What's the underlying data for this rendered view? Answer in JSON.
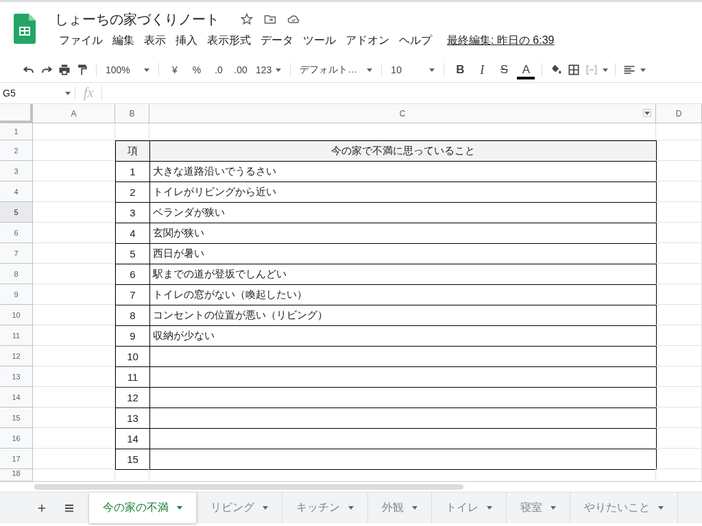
{
  "document": {
    "title": "しょーちの家づくりノート",
    "last_edit": "最終編集: 昨日の 6:39"
  },
  "menu": [
    "ファイル",
    "編集",
    "表示",
    "挿入",
    "表示形式",
    "データ",
    "ツール",
    "アドオン",
    "ヘルプ"
  ],
  "toolbar": {
    "zoom": "100%",
    "currency": "¥",
    "percent": "%",
    "decimal_decrease": ".0",
    "decimal_increase": ".00",
    "number_format": "123",
    "font": "デフォルト…",
    "font_size": "10",
    "bold": "B",
    "italic": "I",
    "strikethrough": "S",
    "text_color": "A"
  },
  "formula_bar": {
    "cell_ref": "G5",
    "fx": "fx"
  },
  "columns": [
    {
      "label": "A",
      "selected": false
    },
    {
      "label": "B",
      "selected": false
    },
    {
      "label": "C",
      "selected": false
    },
    {
      "label": "D",
      "selected": false
    }
  ],
  "row_headers": [
    {
      "label": "1",
      "selected": false
    },
    {
      "label": "2",
      "selected": false
    },
    {
      "label": "3",
      "selected": false
    },
    {
      "label": "4",
      "selected": false
    },
    {
      "label": "5",
      "selected": true
    },
    {
      "label": "6",
      "selected": false
    },
    {
      "label": "7",
      "selected": false
    },
    {
      "label": "8",
      "selected": false
    },
    {
      "label": "9",
      "selected": false
    },
    {
      "label": "10",
      "selected": false
    },
    {
      "label": "11",
      "selected": false
    },
    {
      "label": "12",
      "selected": false
    },
    {
      "label": "13",
      "selected": false
    },
    {
      "label": "14",
      "selected": false
    },
    {
      "label": "15",
      "selected": false
    },
    {
      "label": "16",
      "selected": false
    },
    {
      "label": "17",
      "selected": false
    },
    {
      "label": "18",
      "selected": false
    }
  ],
  "table": {
    "header": [
      "項",
      "今の家で不満に思っていること"
    ],
    "rows": [
      {
        "no": "1",
        "text": "大きな道路沿いでうるさい"
      },
      {
        "no": "2",
        "text": "トイレがリビングから近い"
      },
      {
        "no": "3",
        "text": "ベランダが狭い"
      },
      {
        "no": "4",
        "text": "玄関が狭い"
      },
      {
        "no": "5",
        "text": "西日が暑い"
      },
      {
        "no": "6",
        "text": "駅までの道が登坂でしんどい"
      },
      {
        "no": "7",
        "text": "トイレの窓がない（喚起したい）"
      },
      {
        "no": "8",
        "text": "コンセントの位置が悪い（リビング）"
      },
      {
        "no": "9",
        "text": "収納が少ない"
      },
      {
        "no": "10",
        "text": ""
      },
      {
        "no": "11",
        "text": ""
      },
      {
        "no": "12",
        "text": ""
      },
      {
        "no": "13",
        "text": ""
      },
      {
        "no": "14",
        "text": ""
      },
      {
        "no": "15",
        "text": ""
      }
    ]
  },
  "sheet_tabs": [
    {
      "label": "今の家の不満",
      "selected": true
    },
    {
      "label": "リビング",
      "selected": false
    },
    {
      "label": "キッチン",
      "selected": false
    },
    {
      "label": "外観",
      "selected": false
    },
    {
      "label": "トイレ",
      "selected": false
    },
    {
      "label": "寝室",
      "selected": false
    },
    {
      "label": "やりたいこと",
      "selected": false
    }
  ]
}
